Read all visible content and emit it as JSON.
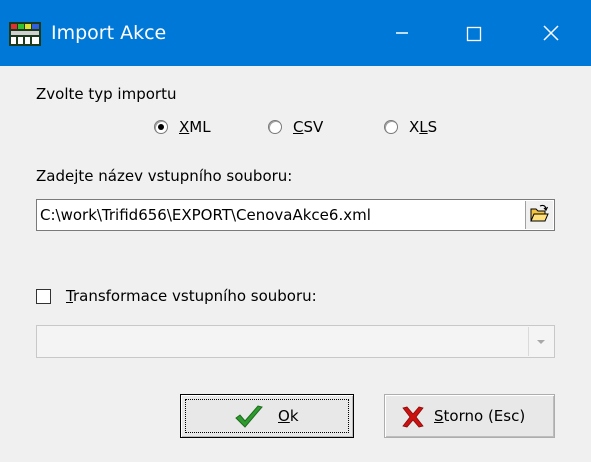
{
  "window": {
    "title": "Import Akce",
    "controls": {
      "minimize": "minimize",
      "maximize": "maximize",
      "close": "close"
    }
  },
  "import_type": {
    "label": "Zvolte typ importu",
    "options": [
      {
        "label": "XML",
        "mnemonic": "X",
        "rest": "ML",
        "selected": true
      },
      {
        "label": "CSV",
        "mnemonic": "C",
        "rest": "SV",
        "selected": false
      },
      {
        "label": "XLS",
        "prefix": "X",
        "mnemonic": "L",
        "rest": "S",
        "selected": false
      }
    ]
  },
  "input_file": {
    "label": "Zadejte název vstupního souboru:",
    "value": "C:\\work\\Trifid656\\EXPORT\\CenovaAkce6.xml",
    "browse_icon": "open-folder-icon"
  },
  "transform": {
    "checked": false,
    "label_mnemonic": "T",
    "label_rest": "ransformace vstupního souboru:",
    "select_value": "",
    "enabled": false
  },
  "buttons": {
    "ok": {
      "mnemonic": "O",
      "rest": "k",
      "icon": "checkmark-icon"
    },
    "cancel": {
      "mnemonic": "S",
      "rest": "torno (Esc)",
      "icon": "red-x-icon"
    }
  },
  "colors": {
    "titlebar": "#0078D7",
    "dialog_bg": "#F0F0F0",
    "ok_icon": "#2E9B2E",
    "cancel_icon": "#CC1111"
  }
}
